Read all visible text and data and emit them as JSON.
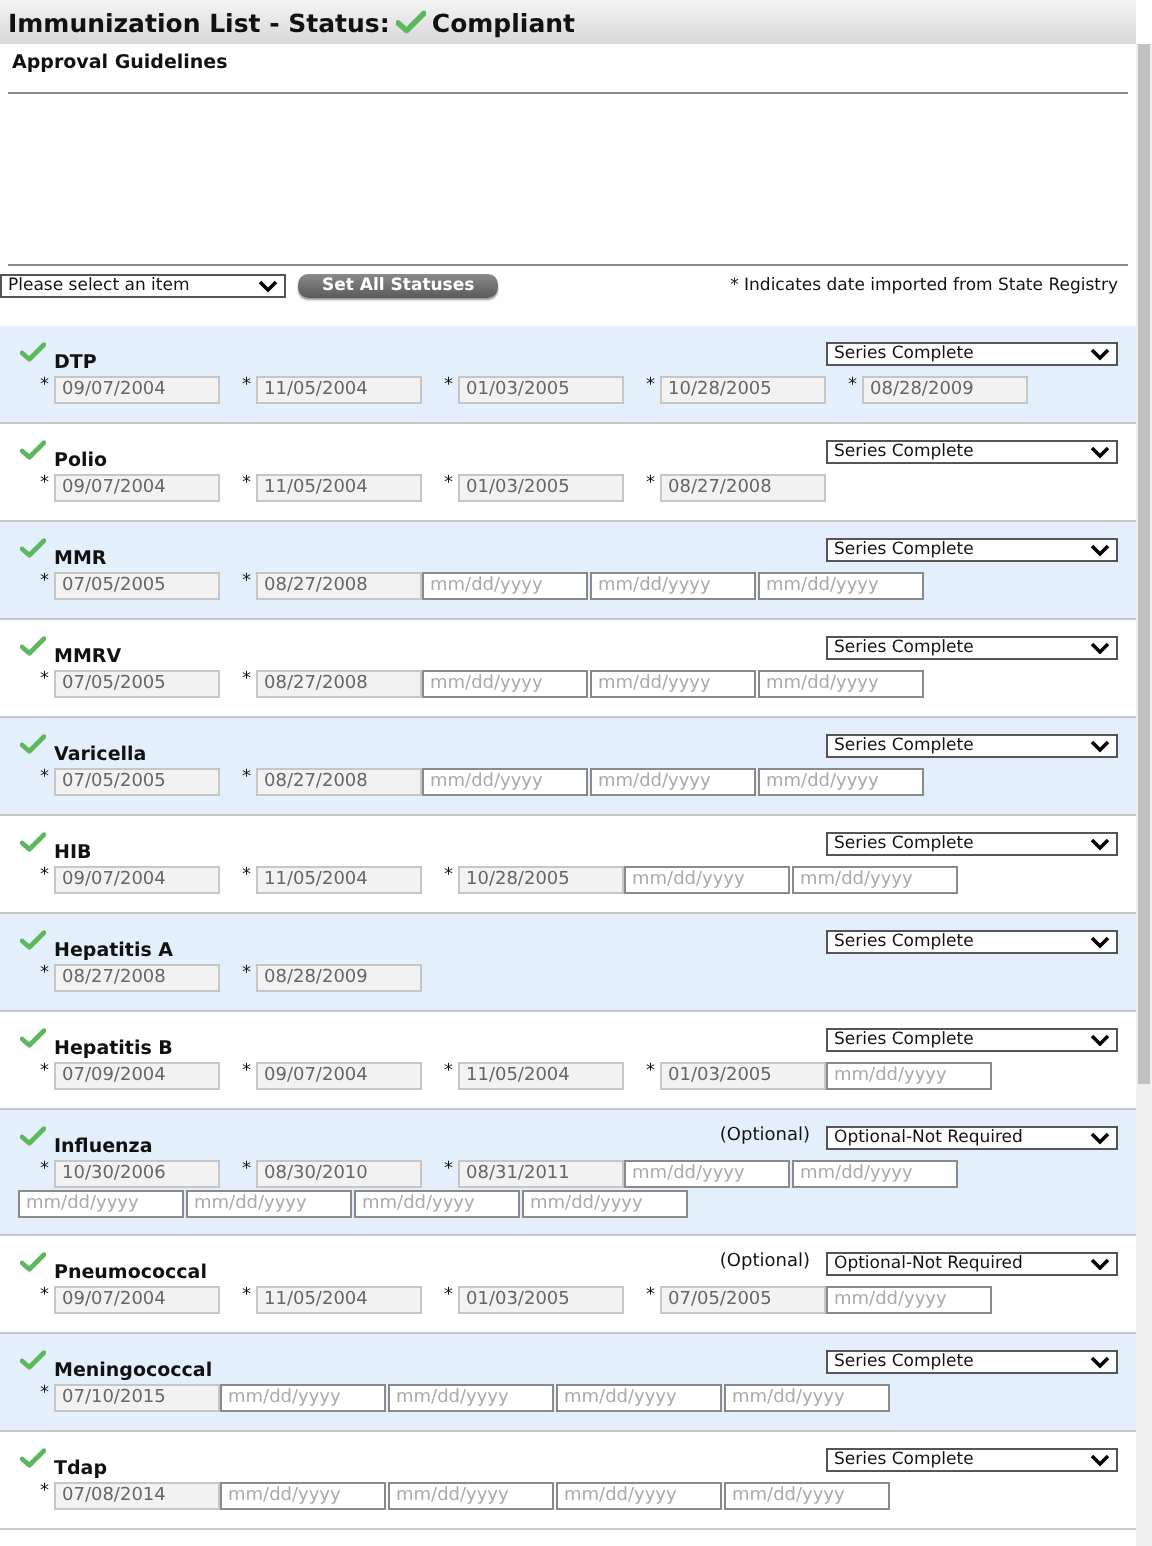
{
  "header": {
    "title": "Immunization List - Status:",
    "status": "Compliant",
    "compliant": true
  },
  "guidelines": {
    "title": "Approval Guidelines"
  },
  "toolbar": {
    "select": "Please select an item",
    "button": "Set All Statuses",
    "note": "* Indicates date imported from State Registry"
  },
  "vaccines": [
    {
      "name": "DTP",
      "compliant": true,
      "status": "Series Complete",
      "doses": [
        {
          "kind": "recorded",
          "mark": "*",
          "value": "09/07/2004"
        },
        {
          "kind": "recorded",
          "mark": "*",
          "value": "11/05/2004"
        },
        {
          "kind": "recorded",
          "mark": "*",
          "value": "01/03/2005"
        },
        {
          "kind": "recorded",
          "mark": "*",
          "value": "10/28/2005"
        },
        {
          "kind": "recorded",
          "mark": "*",
          "value": "08/28/2009"
        }
      ]
    },
    {
      "name": "Polio",
      "compliant": true,
      "status": "Series Complete",
      "doses": [
        {
          "kind": "recorded",
          "mark": "*",
          "value": "09/07/2004"
        },
        {
          "kind": "recorded",
          "mark": "*",
          "value": "11/05/2004"
        },
        {
          "kind": "recorded",
          "mark": "*",
          "value": "01/03/2005"
        },
        {
          "kind": "recorded",
          "mark": "*",
          "value": "08/27/2008"
        }
      ]
    },
    {
      "name": "MMR",
      "compliant": true,
      "status": "Series Complete",
      "doses": [
        {
          "kind": "recorded",
          "mark": "*",
          "value": "07/05/2005"
        },
        {
          "kind": "recorded",
          "mark": "*",
          "value": "08/27/2008"
        },
        {
          "kind": "blank",
          "placeholder": "mm/dd/yyyy"
        },
        {
          "kind": "blank",
          "placeholder": "mm/dd/yyyy"
        },
        {
          "kind": "blank",
          "placeholder": "mm/dd/yyyy"
        }
      ]
    },
    {
      "name": "MMRV",
      "compliant": true,
      "status": "Series Complete",
      "doses": [
        {
          "kind": "recorded",
          "mark": "*",
          "value": "07/05/2005"
        },
        {
          "kind": "recorded",
          "mark": "*",
          "value": "08/27/2008"
        },
        {
          "kind": "blank",
          "placeholder": "mm/dd/yyyy"
        },
        {
          "kind": "blank",
          "placeholder": "mm/dd/yyyy"
        },
        {
          "kind": "blank",
          "placeholder": "mm/dd/yyyy"
        }
      ]
    },
    {
      "name": "Varicella",
      "compliant": true,
      "status": "Series Complete",
      "doses": [
        {
          "kind": "recorded",
          "mark": "*",
          "value": "07/05/2005"
        },
        {
          "kind": "recorded",
          "mark": "*",
          "value": "08/27/2008"
        },
        {
          "kind": "blank",
          "placeholder": "mm/dd/yyyy"
        },
        {
          "kind": "blank",
          "placeholder": "mm/dd/yyyy"
        },
        {
          "kind": "blank",
          "placeholder": "mm/dd/yyyy"
        }
      ]
    },
    {
      "name": "HIB",
      "compliant": true,
      "status": "Series Complete",
      "doses": [
        {
          "kind": "recorded",
          "mark": "*",
          "value": "09/07/2004"
        },
        {
          "kind": "recorded",
          "mark": "*",
          "value": "11/05/2004"
        },
        {
          "kind": "recorded",
          "mark": "*",
          "value": "10/28/2005"
        },
        {
          "kind": "blank",
          "placeholder": "mm/dd/yyyy"
        },
        {
          "kind": "blank",
          "placeholder": "mm/dd/yyyy"
        }
      ]
    },
    {
      "name": "Hepatitis A",
      "compliant": true,
      "status": "Series Complete",
      "doses": [
        {
          "kind": "recorded",
          "mark": "*",
          "value": "08/27/2008"
        },
        {
          "kind": "recorded",
          "mark": "*",
          "value": "08/28/2009"
        }
      ]
    },
    {
      "name": "Hepatitis B",
      "compliant": true,
      "status": "Series Complete",
      "doses": [
        {
          "kind": "recorded",
          "mark": "*",
          "value": "07/09/2004"
        },
        {
          "kind": "recorded",
          "mark": "*",
          "value": "09/07/2004"
        },
        {
          "kind": "recorded",
          "mark": "*",
          "value": "11/05/2004"
        },
        {
          "kind": "recorded",
          "mark": "*",
          "value": "01/03/2005"
        },
        {
          "kind": "blank",
          "placeholder": "mm/dd/yyyy"
        }
      ]
    },
    {
      "name": "Influenza",
      "compliant": true,
      "note": "(Optional)",
      "status": "Optional-Not Required",
      "doses": [
        {
          "kind": "recorded",
          "mark": "*",
          "value": "10/30/2006"
        },
        {
          "kind": "recorded",
          "mark": "*",
          "value": "08/30/2010"
        },
        {
          "kind": "recorded",
          "mark": "*",
          "value": "08/31/2011"
        },
        {
          "kind": "blank",
          "placeholder": "mm/dd/yyyy"
        },
        {
          "kind": "blank",
          "placeholder": "mm/dd/yyyy"
        },
        {
          "kind": "blank",
          "placeholder": "mm/dd/yyyy"
        },
        {
          "kind": "blank",
          "placeholder": "mm/dd/yyyy"
        },
        {
          "kind": "blank",
          "placeholder": "mm/dd/yyyy"
        },
        {
          "kind": "blank",
          "placeholder": "mm/dd/yyyy"
        }
      ]
    },
    {
      "name": "Pneumococcal",
      "compliant": true,
      "note": "(Optional)",
      "status": "Optional-Not Required",
      "doses": [
        {
          "kind": "recorded",
          "mark": "*",
          "value": "09/07/2004"
        },
        {
          "kind": "recorded",
          "mark": "*",
          "value": "11/05/2004"
        },
        {
          "kind": "recorded",
          "mark": "*",
          "value": "01/03/2005"
        },
        {
          "kind": "recorded",
          "mark": "*",
          "value": "07/05/2005"
        },
        {
          "kind": "blank",
          "placeholder": "mm/dd/yyyy"
        }
      ]
    },
    {
      "name": "Meningococcal",
      "compliant": true,
      "status": "Series Complete",
      "doses": [
        {
          "kind": "recorded",
          "mark": "*",
          "value": "07/10/2015"
        },
        {
          "kind": "blank",
          "placeholder": "mm/dd/yyyy"
        },
        {
          "kind": "blank",
          "placeholder": "mm/dd/yyyy"
        },
        {
          "kind": "blank",
          "placeholder": "mm/dd/yyyy"
        },
        {
          "kind": "blank",
          "placeholder": "mm/dd/yyyy"
        }
      ]
    },
    {
      "name": "Tdap",
      "compliant": true,
      "status": "Series Complete",
      "doses": [
        {
          "kind": "recorded",
          "mark": "*",
          "value": "07/08/2014"
        },
        {
          "kind": "blank",
          "placeholder": "mm/dd/yyyy"
        },
        {
          "kind": "blank",
          "placeholder": "mm/dd/yyyy"
        },
        {
          "kind": "blank",
          "placeholder": "mm/dd/yyyy"
        },
        {
          "kind": "blank",
          "placeholder": "mm/dd/yyyy"
        }
      ]
    }
  ]
}
